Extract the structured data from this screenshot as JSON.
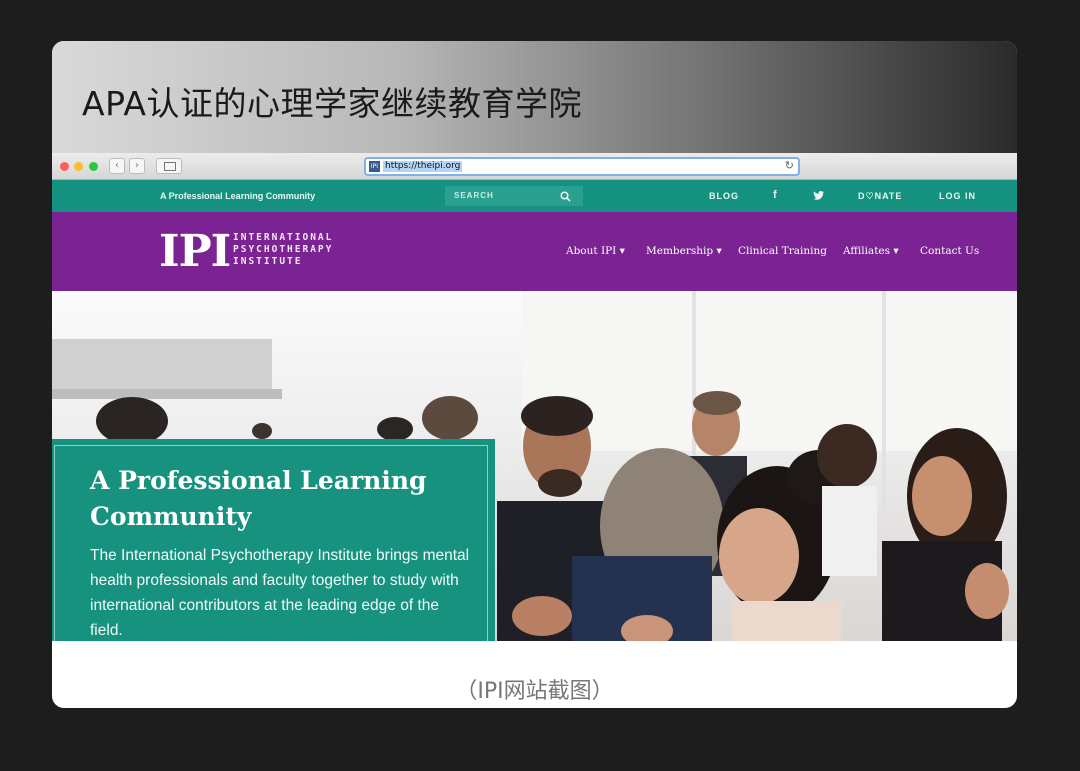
{
  "slide": {
    "title": "APA认证的心理学家继续教育学院",
    "caption": "（IPI网站截图）"
  },
  "browser": {
    "url": "https://theipi.org",
    "favicon_text": "IPI",
    "back_glyph": "‹",
    "forward_glyph": "›",
    "reload_glyph": "↻"
  },
  "topbar": {
    "tagline": "A Professional Learning Community",
    "search_placeholder": "SEARCH",
    "search_icon": "search-icon",
    "blog": "BLOG",
    "facebook": "f",
    "twitter": "🐦",
    "donate": "D♡NATE",
    "login": "LOG IN"
  },
  "nav": {
    "logo_mark": "IPI",
    "logo_line1": "INTERNATIONAL",
    "logo_line2": "PSYCHOTHERAPY",
    "logo_line3": "INSTITUTE",
    "items": [
      "About IPI ▾",
      "Membership ▾",
      "Clinical Training",
      "Affiliates ▾",
      "Contact Us"
    ]
  },
  "hero": {
    "title": "A Professional Learning Community",
    "body": "The International Psychotherapy Institute brings mental health professionals and faculty together to study with international contributors at the leading edge of the field."
  },
  "colors": {
    "teal": "#14917f",
    "purple": "#7b2393"
  }
}
